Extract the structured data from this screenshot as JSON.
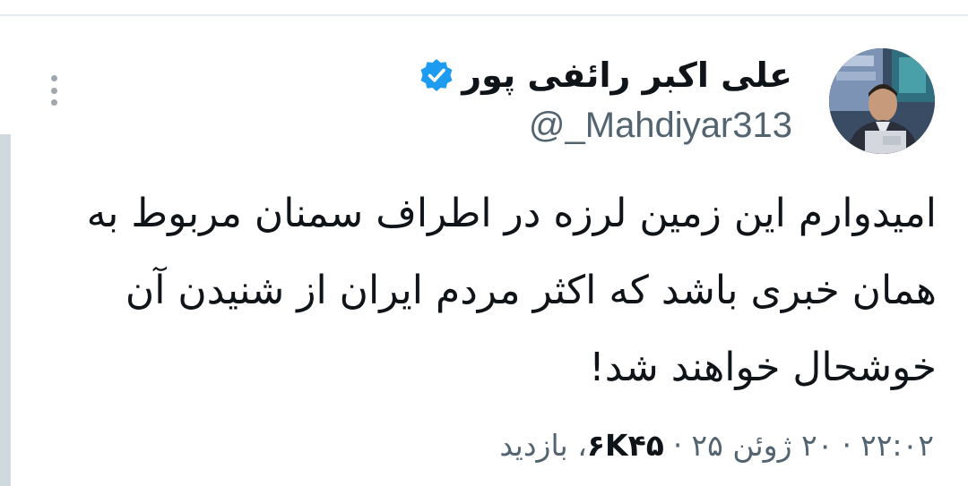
{
  "tweet": {
    "author": {
      "display_name": "علی اکبر رائفی پور",
      "handle": "@_Mahdiyar313",
      "verified": true,
      "verified_color": "#1d9bf0",
      "avatar_icon": "avatar-photo"
    },
    "text": "امیدوارم این زمین لرزه در اطراف سمنان مربوط به همان خبری باشد که اکثر مردم ایران از شنیدن آن خوشحال خواهند شد!",
    "meta": {
      "time": "۲۲:۰۲",
      "separator_1": "·",
      "date": "۲۰ ژوئن ۲۵",
      "separator_2": "·",
      "views_count": "۶K۴۵",
      "views_label": "بازدید"
    },
    "menu_icon": "more-vertical-icon"
  }
}
